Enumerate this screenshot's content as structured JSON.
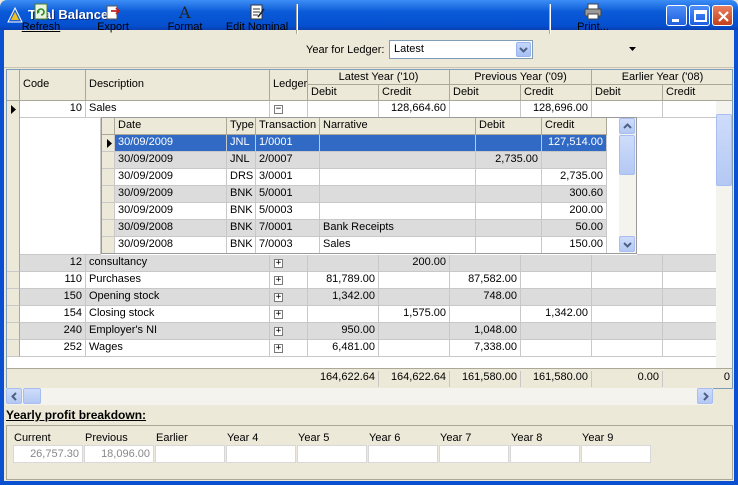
{
  "window": {
    "title": "Trial Balance"
  },
  "toolbar": {
    "refresh": "Refresh",
    "export": "Export",
    "format": "Format",
    "edit_nominal": "Edit Nominal",
    "year_label": "Year for Ledger:",
    "year_value": "Latest",
    "print": "Print..."
  },
  "grid": {
    "headers": {
      "code": "Code",
      "description": "Description",
      "ledger": "Ledger",
      "latest_year": "Latest Year ('10)",
      "previous_year": "Previous Year ('09)",
      "earlier_year": "Earlier Year ('08)",
      "debit": "Debit",
      "credit": "Credit"
    },
    "rows": [
      {
        "code": "10",
        "description": "Sales",
        "ldebit": "",
        "lcredit": "128,664.60",
        "pdebit": "",
        "pcredit": "128,696.00",
        "edebit": "",
        "ecredit": ""
      },
      {
        "code": "12",
        "description": "consultancy",
        "ldebit": "",
        "lcredit": "200.00",
        "pdebit": "",
        "pcredit": "",
        "edebit": "",
        "ecredit": ""
      },
      {
        "code": "110",
        "description": "Purchases",
        "ldebit": "81,789.00",
        "lcredit": "",
        "pdebit": "87,582.00",
        "pcredit": "",
        "edebit": "",
        "ecredit": ""
      },
      {
        "code": "150",
        "description": "Opening stock",
        "ldebit": "1,342.00",
        "lcredit": "",
        "pdebit": "748.00",
        "pcredit": "",
        "edebit": "",
        "ecredit": ""
      },
      {
        "code": "154",
        "description": "Closing stock",
        "ldebit": "",
        "lcredit": "1,575.00",
        "pdebit": "",
        "pcredit": "1,342.00",
        "edebit": "",
        "ecredit": ""
      },
      {
        "code": "240",
        "description": "Employer's NI",
        "ldebit": "950.00",
        "lcredit": "",
        "pdebit": "1,048.00",
        "pcredit": "",
        "edebit": "",
        "ecredit": ""
      },
      {
        "code": "252",
        "description": "Wages",
        "ldebit": "6,481.00",
        "lcredit": "",
        "pdebit": "7,338.00",
        "pcredit": "",
        "edebit": "",
        "ecredit": ""
      }
    ],
    "totals": [
      "164,622.64",
      "164,622.64",
      "161,580.00",
      "161,580.00",
      "0.00",
      "0"
    ],
    "detail": {
      "headers": {
        "date": "Date",
        "type": "Type",
        "transaction": "Transaction",
        "narrative": "Narrative",
        "debit": "Debit",
        "credit": "Credit"
      },
      "rows": [
        {
          "date": "30/09/2009",
          "type": "JNL",
          "transaction": "1/0001",
          "narrative": "",
          "debit": "",
          "credit": "127,514.00"
        },
        {
          "date": "30/09/2009",
          "type": "JNL",
          "transaction": "2/0007",
          "narrative": "",
          "debit": "2,735.00",
          "credit": ""
        },
        {
          "date": "30/09/2009",
          "type": "DRS",
          "transaction": "3/0001",
          "narrative": "",
          "debit": "",
          "credit": "2,735.00"
        },
        {
          "date": "30/09/2009",
          "type": "BNK",
          "transaction": "5/0001",
          "narrative": "",
          "debit": "",
          "credit": "300.60"
        },
        {
          "date": "30/09/2009",
          "type": "BNK",
          "transaction": "5/0003",
          "narrative": "",
          "debit": "",
          "credit": "200.00"
        },
        {
          "date": "30/09/2008",
          "type": "BNK",
          "transaction": "7/0001",
          "narrative": "Bank Receipts",
          "debit": "",
          "credit": "50.00"
        },
        {
          "date": "30/09/2008",
          "type": "BNK",
          "transaction": "7/0003",
          "narrative": "Sales",
          "debit": "",
          "credit": "150.00"
        }
      ]
    }
  },
  "profit": {
    "title": "Yearly profit breakdown:",
    "labels": [
      "Current",
      "Previous",
      "Earlier",
      "Year 4",
      "Year 5",
      "Year 6",
      "Year 7",
      "Year 8",
      "Year 9"
    ],
    "values": [
      "26,757.30",
      "18,096.00",
      "",
      "",
      "",
      "",
      "",
      "",
      ""
    ]
  }
}
